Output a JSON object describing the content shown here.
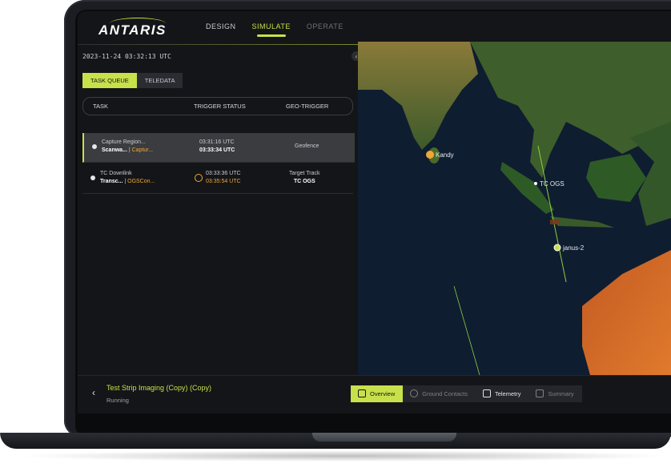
{
  "app": {
    "logo": "ANTARIS",
    "nav": [
      {
        "label": "DESIGN",
        "state": "normal"
      },
      {
        "label": "SIMULATE",
        "state": "active"
      },
      {
        "label": "OPERATE",
        "state": "dim"
      }
    ]
  },
  "left_panel": {
    "timestamp": "2023-11-24 03:32:13 UTC",
    "tabs": [
      {
        "label": "TASK QUEUE",
        "active": true
      },
      {
        "label": "TELEDATA",
        "active": false
      }
    ],
    "columns": [
      "TASK",
      "TRIGGER STATUS",
      "GEO-TRIGGER"
    ],
    "rows": [
      {
        "task_line1": "Capture Region...",
        "task_line2a": "Scanwa...",
        "task_sep": " | ",
        "task_line2b": "Captur...",
        "trigger_line1": "03:31:16 UTC",
        "trigger_line2": "03:33:34 UTC",
        "geo_line1": "Geofence",
        "geo_line2": ""
      },
      {
        "task_line1": "TC Downlink",
        "task_line2a": "Transc...",
        "task_sep": " | ",
        "task_line2b": "OGSCon...",
        "trigger_line1": "03:33:36 UTC",
        "trigger_line2": "03:35:54 UTC",
        "geo_line1": "Target Track",
        "geo_line2": "TC OGS"
      }
    ]
  },
  "map": {
    "labels": [
      "Kandy",
      "TC OGS",
      "janus-2"
    ]
  },
  "footer": {
    "mission_title": "Test Strip Imaging (Copy) (Copy)",
    "mission_status": "Running",
    "tabs": [
      {
        "label": "Overview",
        "icon": "overview-icon",
        "state": "active"
      },
      {
        "label": "Ground Contacts",
        "icon": "globe-icon",
        "state": "normal"
      },
      {
        "label": "Telemetry",
        "icon": "telemetry-icon",
        "state": "bright"
      },
      {
        "label": "Summary",
        "icon": "summary-icon",
        "state": "normal"
      }
    ]
  },
  "colors": {
    "accent": "#c8e04a",
    "warning": "#f0a733",
    "background": "#141518"
  }
}
